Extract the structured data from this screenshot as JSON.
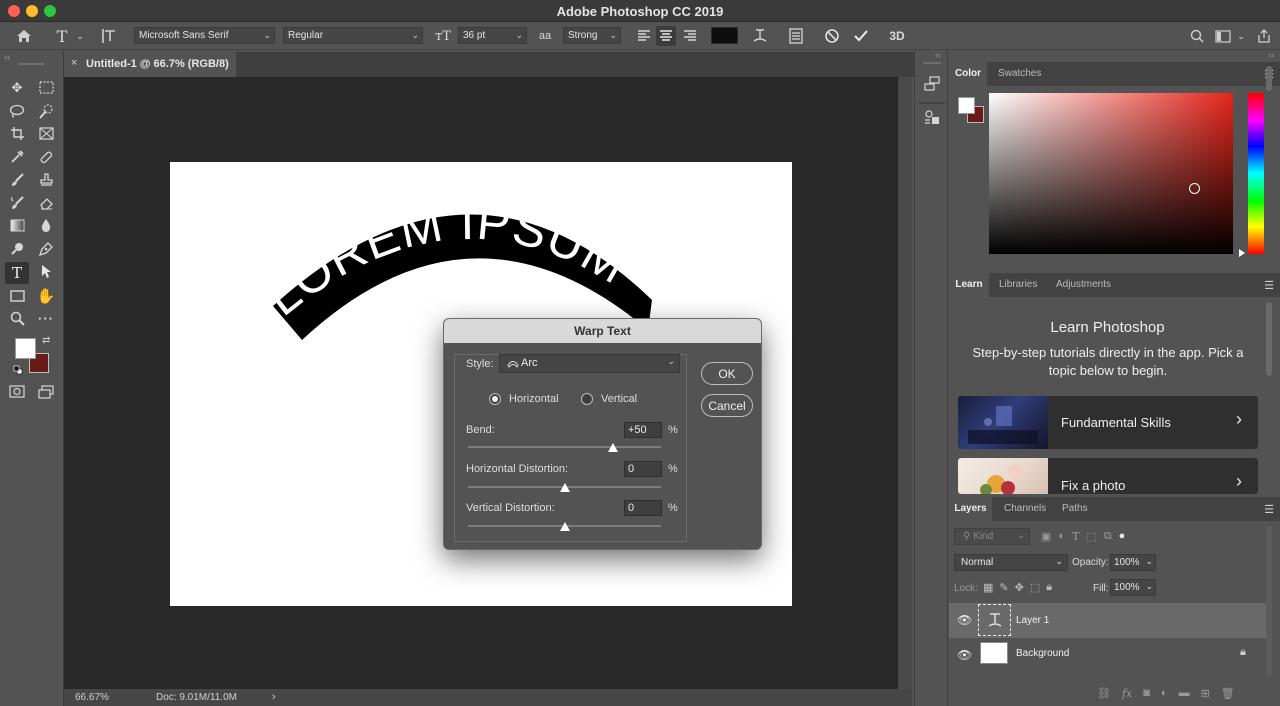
{
  "app": {
    "title": "Adobe Photoshop CC 2019"
  },
  "options": {
    "font_family": "Microsoft Sans Serif",
    "font_style": "Regular",
    "font_size": "36 pt",
    "aa_icon": "aa",
    "antialias": "Strong",
    "three_d": "3D",
    "text_color": "#0d0d0d"
  },
  "document": {
    "tab_label": "Untitled-1 @ 66.7% (RGB/8)",
    "warped_text": "LOREM IPSUM",
    "zoom": "66.67%",
    "doc_info": "Doc: 9.01M/11.0M"
  },
  "warp_dialog": {
    "title": "Warp Text",
    "style_label": "Style:",
    "style_value": "Arc",
    "horizontal_label": "Horizontal",
    "vertical_label": "Vertical",
    "orientation": "Horizontal",
    "bend_label": "Bend:",
    "bend_value": "+50",
    "bend": 50,
    "hdist_label": "Horizontal Distortion:",
    "hdist_value": "0",
    "hdist": 0,
    "vdist_label": "Vertical Distortion:",
    "vdist_value": "0",
    "vdist": 0,
    "percent": "%",
    "ok": "OK",
    "cancel": "Cancel"
  },
  "color_panel": {
    "tabs": [
      "Color",
      "Swatches"
    ],
    "foreground": "#ffffff",
    "background": "#6b1a1a"
  },
  "learn_panel": {
    "tabs": [
      "Learn",
      "Libraries",
      "Adjustments"
    ],
    "heading": "Learn Photoshop",
    "description": "Step-by-step tutorials directly in the app. Pick a topic below to begin.",
    "cards": [
      {
        "label": "Fundamental Skills"
      },
      {
        "label": "Fix a photo"
      }
    ]
  },
  "layers_panel": {
    "tabs": [
      "Layers",
      "Channels",
      "Paths"
    ],
    "filter_placeholder": "Kind",
    "blend_mode": "Normal",
    "opacity_label": "Opacity:",
    "opacity": "100%",
    "lock_label": "Lock:",
    "fill_label": "Fill:",
    "fill": "100%",
    "layers": [
      {
        "name": "Layer 1",
        "type": "text",
        "selected": true
      },
      {
        "name": "Background",
        "type": "background",
        "locked": true
      }
    ]
  }
}
